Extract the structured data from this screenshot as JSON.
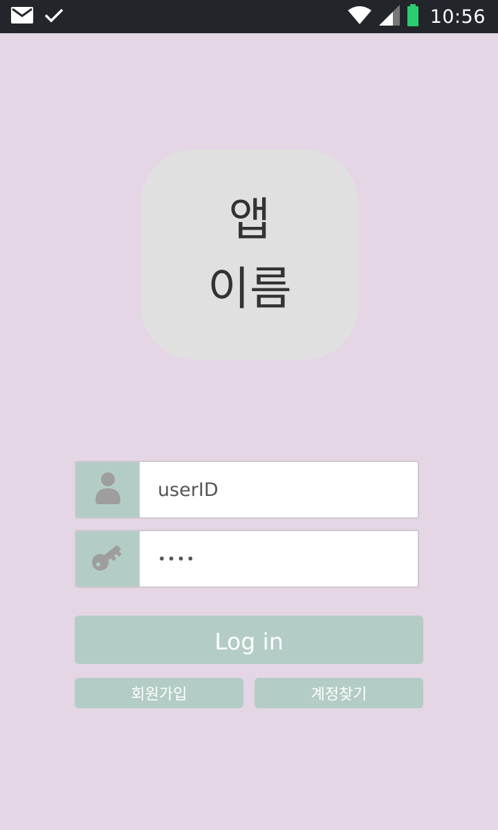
{
  "status_bar": {
    "time": "10:56",
    "left_icons": [
      "mail-icon",
      "check-icon"
    ],
    "right_icons": [
      "wifi-icon",
      "signal-icon",
      "battery-icon"
    ],
    "battery_color": "#2ecc71"
  },
  "logo": {
    "line1": "앱",
    "line2": "이름"
  },
  "form": {
    "user_id_value": "userID",
    "password_value": "••••",
    "user_icon": "person-icon",
    "password_icon": "key-icon"
  },
  "buttons": {
    "login_label": "Log in",
    "signup_label": "회원가입",
    "find_account_label": "계정찾기"
  },
  "colors": {
    "background": "#e4d6e5",
    "accent": "#b3cdc6",
    "status_bar": "#22262b",
    "logo_box": "#e0e0e0"
  }
}
